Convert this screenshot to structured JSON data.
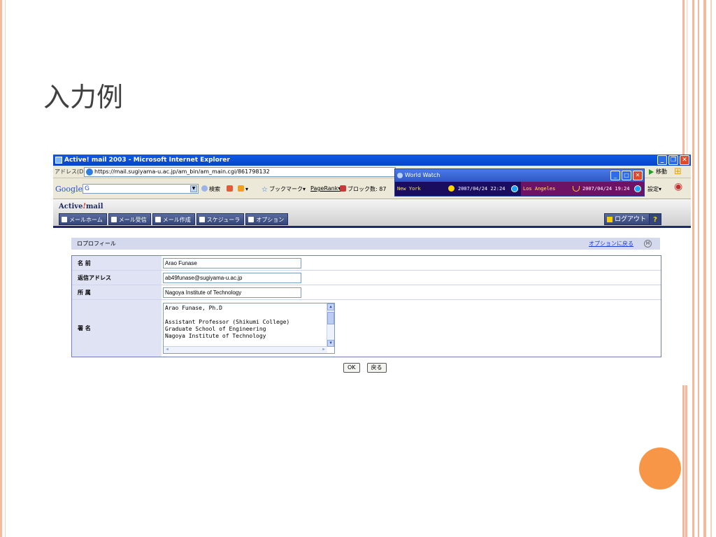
{
  "slide": {
    "title": "入力例"
  },
  "window": {
    "title": "Active! mail 2003 - Microsoft Internet Explorer",
    "address_label": "アドレス(D)",
    "url": "https://mail.sugiyama-u.ac.jp/am_bin/am_main.cgi/861798132",
    "go_label": "移動"
  },
  "toolbar": {
    "google_logo": "Google",
    "google_box": "G",
    "search_label": "検索",
    "bookmark_label": "ブックマーク",
    "pagerank_label": "PageRank",
    "blocked_label": "ブロック数: 87",
    "settings_label": "設定"
  },
  "world_watch": {
    "title": "World Watch",
    "city1": "New York",
    "time1": "2007/04/24 22:24",
    "city2": "Los Angeles",
    "time2": "2007/04/24 19:24"
  },
  "amail": {
    "logo_pre": "Active",
    "logo_bang": "!",
    "logo_post": "mail",
    "nav": [
      "メールホーム",
      "メール受信",
      "メール作成",
      "スケジューラ",
      "オプション"
    ],
    "logout": "ログアウト",
    "help": "?"
  },
  "profile": {
    "section_title": "ロプロフィール",
    "options_link": "オプションに戻る",
    "h_badge": "H",
    "labels": {
      "name": "名 前",
      "reply_address": "返信アドレス",
      "affiliation": "所 属",
      "signature": "署 名"
    },
    "values": {
      "name": "Arao Funase",
      "reply_address": "ab49funase@sugiyama-u.ac.jp",
      "affiliation": "Nagoya Institute of Technology"
    },
    "signature_lines": [
      "Arao Funase, Ph.D",
      "",
      "Assistant Professor (Shikumi College)",
      "Graduate School of Engineering",
      "Nagoya Institute of Technology"
    ],
    "ok_label": "OK",
    "back_label": "戻る"
  },
  "colors": {
    "accent_orange": "#f79646",
    "border_peach": "#f4b89c",
    "xp_blue": "#0a5be8",
    "amail_navy": "#1c2a6b"
  }
}
